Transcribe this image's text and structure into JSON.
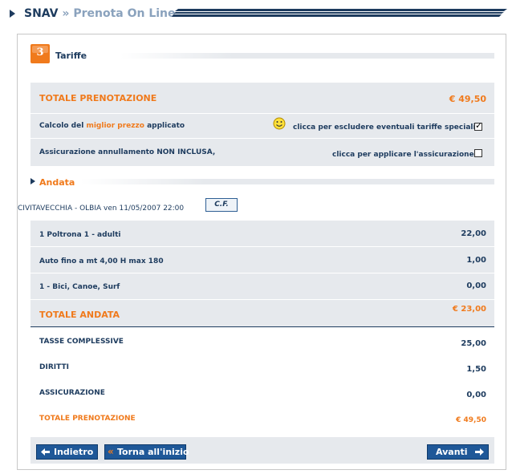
{
  "header": {
    "brand": "SNAV",
    "sep": "»",
    "title": "Prenota On Line"
  },
  "step": {
    "number": "3",
    "title": "Tariffe"
  },
  "summary": {
    "total_label": "TOTALE PRENOTAZIONE",
    "total_value": "€ 49,50",
    "best_price_pre": "Calcolo del",
    "best_price_highlight": "miglior prezzo",
    "best_price_post": "applicato",
    "best_price_action": "clicca per escludere eventuali tariffe speciali",
    "best_price_checked": true,
    "insurance_label": "Assicurazione annullamento NON INCLUSA,",
    "insurance_action": "clicca per applicare l'assicurazione",
    "insurance_checked": false
  },
  "andata": {
    "title": "Andata",
    "route": "CIVITAVECCHIA - OLBIA ven 11/05/2007 22:00",
    "cf_label": "C.F.",
    "items": [
      {
        "label": "1 Poltrona 1 - adulti",
        "value": "22,00"
      },
      {
        "label": "Auto fino a mt 4,00 H max 180",
        "value": "1,00"
      },
      {
        "label": "1 - Bici, Canoe, Surf",
        "value": "0,00"
      }
    ],
    "total_label": "TOTALE ANDATA",
    "total_value": "€ 23,00"
  },
  "totals": {
    "rows": [
      {
        "label": "TASSE COMPLESSIVE",
        "value": "25,00"
      },
      {
        "label": "DIRITTI",
        "value": "1,50"
      },
      {
        "label": "ASSICURAZIONE",
        "value": "0,00"
      }
    ],
    "total_label": "TOTALE PRENOTAZIONE",
    "total_value": "€ 49,50"
  },
  "nav": {
    "back": "Indietro",
    "restart": "Torna all'inizio",
    "next": "Avanti"
  },
  "colors": {
    "navy": "#1d3b5e",
    "orange": "#f07a1c",
    "panel_gray": "#e6e9ed",
    "button_blue": "#1f5898"
  },
  "icons": {
    "smiley": "smiley-icon",
    "arrow_left": "arrow-left-icon",
    "double_chevron": "double-chevron-left-icon",
    "arrow_right": "arrow-right-icon"
  }
}
